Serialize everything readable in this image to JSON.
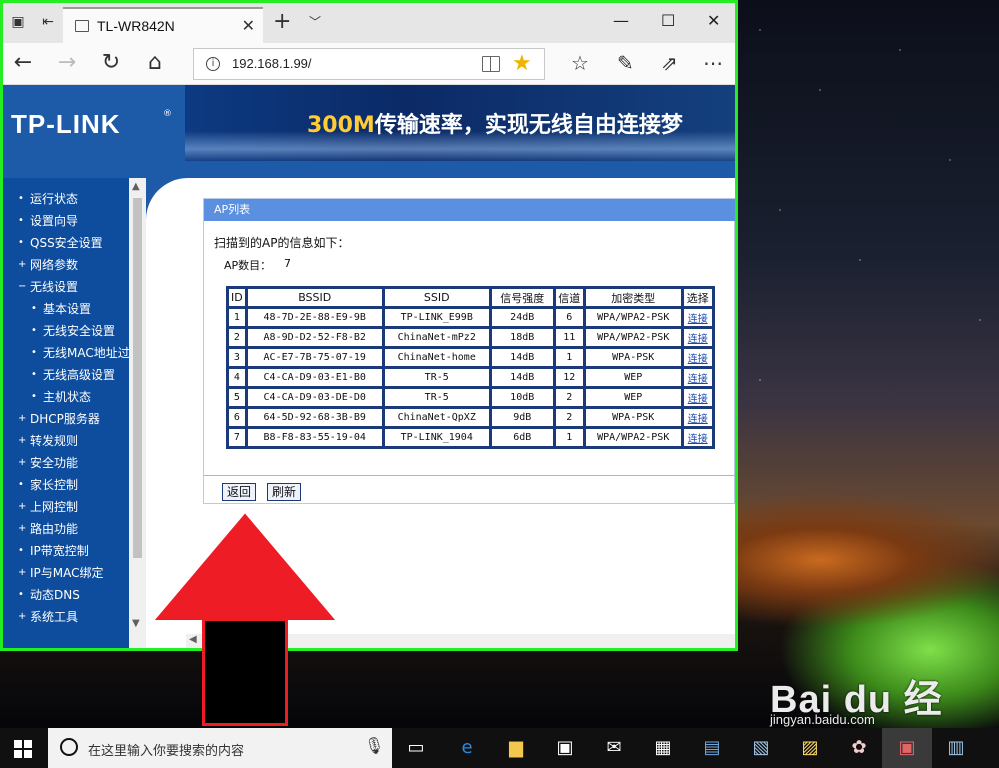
{
  "browser": {
    "tab_title": "TL-WR842N",
    "url": "192.168.1.99/"
  },
  "router": {
    "logo": "TP-LINK",
    "logo_reg": "®",
    "slogan_highlight": "300M",
    "slogan_rest": "传输速率，实现无线自由连接梦"
  },
  "sidebar": {
    "items": [
      {
        "bullet": "•",
        "label": "运行状态"
      },
      {
        "bullet": "•",
        "label": "设置向导"
      },
      {
        "bullet": "•",
        "label": "QSS安全设置"
      },
      {
        "bullet": "+",
        "label": "网络参数"
      },
      {
        "bullet": "−",
        "label": "无线设置"
      },
      {
        "bullet": "•",
        "label": "基本设置"
      },
      {
        "bullet": "•",
        "label": "无线安全设置"
      },
      {
        "bullet": "•",
        "label": "无线MAC地址过滤"
      },
      {
        "bullet": "•",
        "label": "无线高级设置"
      },
      {
        "bullet": "•",
        "label": "主机状态"
      },
      {
        "bullet": "+",
        "label": "DHCP服务器"
      },
      {
        "bullet": "+",
        "label": "转发规则"
      },
      {
        "bullet": "+",
        "label": "安全功能"
      },
      {
        "bullet": "•",
        "label": "家长控制"
      },
      {
        "bullet": "+",
        "label": "上网控制"
      },
      {
        "bullet": "+",
        "label": "路由功能"
      },
      {
        "bullet": "•",
        "label": "IP带宽控制"
      },
      {
        "bullet": "+",
        "label": "IP与MAC绑定"
      },
      {
        "bullet": "•",
        "label": "动态DNS"
      },
      {
        "bullet": "+",
        "label": "系统工具"
      }
    ]
  },
  "ap_list": {
    "panel_title": "AP列表",
    "scan_note": "扫描到的AP的信息如下：",
    "count_label": "AP数目：",
    "count_value": "7",
    "columns": [
      "ID",
      "BSSID",
      "SSID",
      "信号强度",
      "信道",
      "加密类型",
      "选择"
    ],
    "rows": [
      [
        "1",
        "48-7D-2E-88-E9-9B",
        "TP-LINK_E99B",
        "24dB",
        "6",
        "WPA/WPA2-PSK",
        "连接"
      ],
      [
        "2",
        "A8-9D-D2-52-F8-B2",
        "ChinaNet-mPz2",
        "18dB",
        "11",
        "WPA/WPA2-PSK",
        "连接"
      ],
      [
        "3",
        "AC-E7-7B-75-07-19",
        "ChinaNet-home",
        "14dB",
        "1",
        "WPA-PSK",
        "连接"
      ],
      [
        "4",
        "C4-CA-D9-03-E1-B0",
        "TR-5",
        "14dB",
        "12",
        "WEP",
        "连接"
      ],
      [
        "5",
        "C4-CA-D9-03-DE-D0",
        "TR-5",
        "10dB",
        "2",
        "WEP",
        "连接"
      ],
      [
        "6",
        "64-5D-92-68-3B-B9",
        "ChinaNet-QpXZ",
        "9dB",
        "2",
        "WPA-PSK",
        "连接"
      ],
      [
        "7",
        "B8-F8-83-55-19-04",
        "TP-LINK_1904",
        "6dB",
        "1",
        "WPA/WPA2-PSK",
        "连接"
      ]
    ],
    "back_button": "返回",
    "refresh_button": "刷新"
  },
  "taskbar": {
    "search_placeholder": "在这里输入你要搜索的内容"
  },
  "watermark": {
    "main": "Bai du 经验",
    "url": "jingyan.baidu.com"
  },
  "colors": {
    "window_border": "#22ee22",
    "router_blue": "#1d5aa8",
    "panel_header": "#5b90e0",
    "annotation_arrow": "#ee1c25"
  }
}
